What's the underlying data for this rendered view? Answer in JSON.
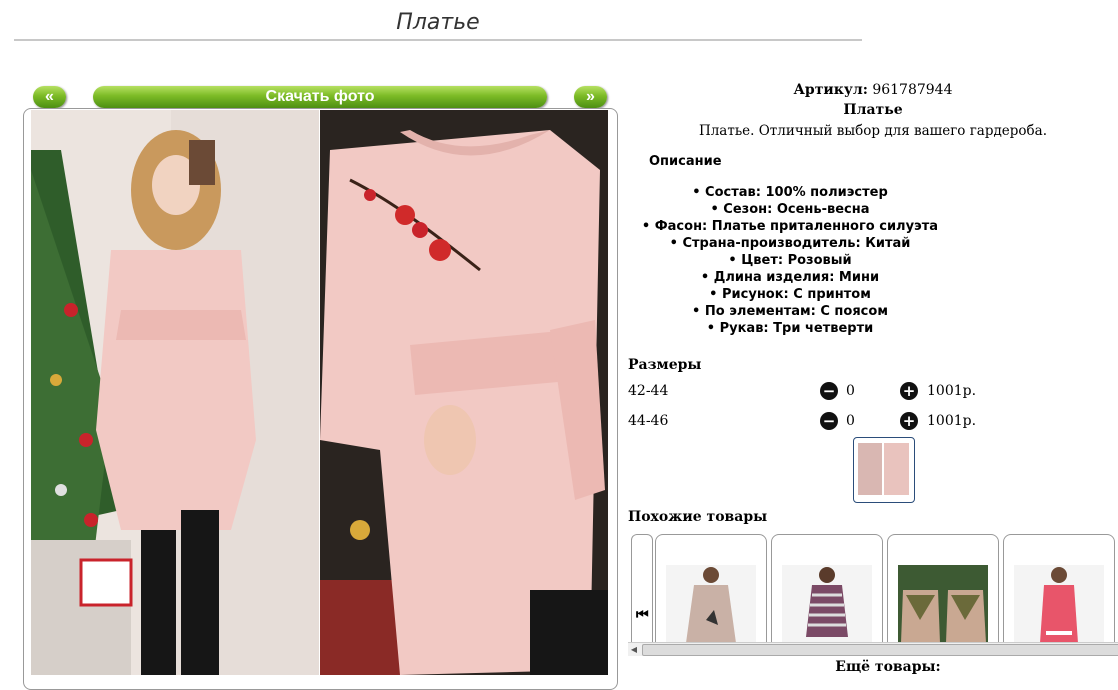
{
  "page": {
    "title": "Платье"
  },
  "gallery": {
    "prev_label": "«",
    "next_label": "»",
    "download_label": "Скачать фото"
  },
  "product": {
    "article_label": "Артикул:",
    "article_value": "961787944",
    "name": "Платье",
    "tagline": "Платье. Отличный выбор для вашего гардероба."
  },
  "description": {
    "heading": "Описание",
    "attributes": [
      "Состав: 100% полиэстер",
      "Сезон: Осень-весна",
      "Фасон: Платье приталенного силуэта",
      "Страна-производитель: Китай",
      "Цвет: Розовый",
      "Длина изделия: Мини",
      "Рисунок: С принтом",
      "По элементам: С поясом",
      "Рукав: Три четверти"
    ]
  },
  "sizes": {
    "heading": "Размеры",
    "items": [
      {
        "size": "42-44",
        "qty": "0",
        "price": "1001р.",
        "minus": "−",
        "plus": "+"
      },
      {
        "size": "44-46",
        "qty": "0",
        "price": "1001р.",
        "minus": "−",
        "plus": "+"
      }
    ]
  },
  "similar": {
    "heading": "Похожие товары",
    "prev_icon": "⏮"
  },
  "more": {
    "label": "Ещё товары:"
  },
  "colors": {
    "accent_green": "#7cbb26",
    "dress_pink": "#f2c9c4"
  }
}
